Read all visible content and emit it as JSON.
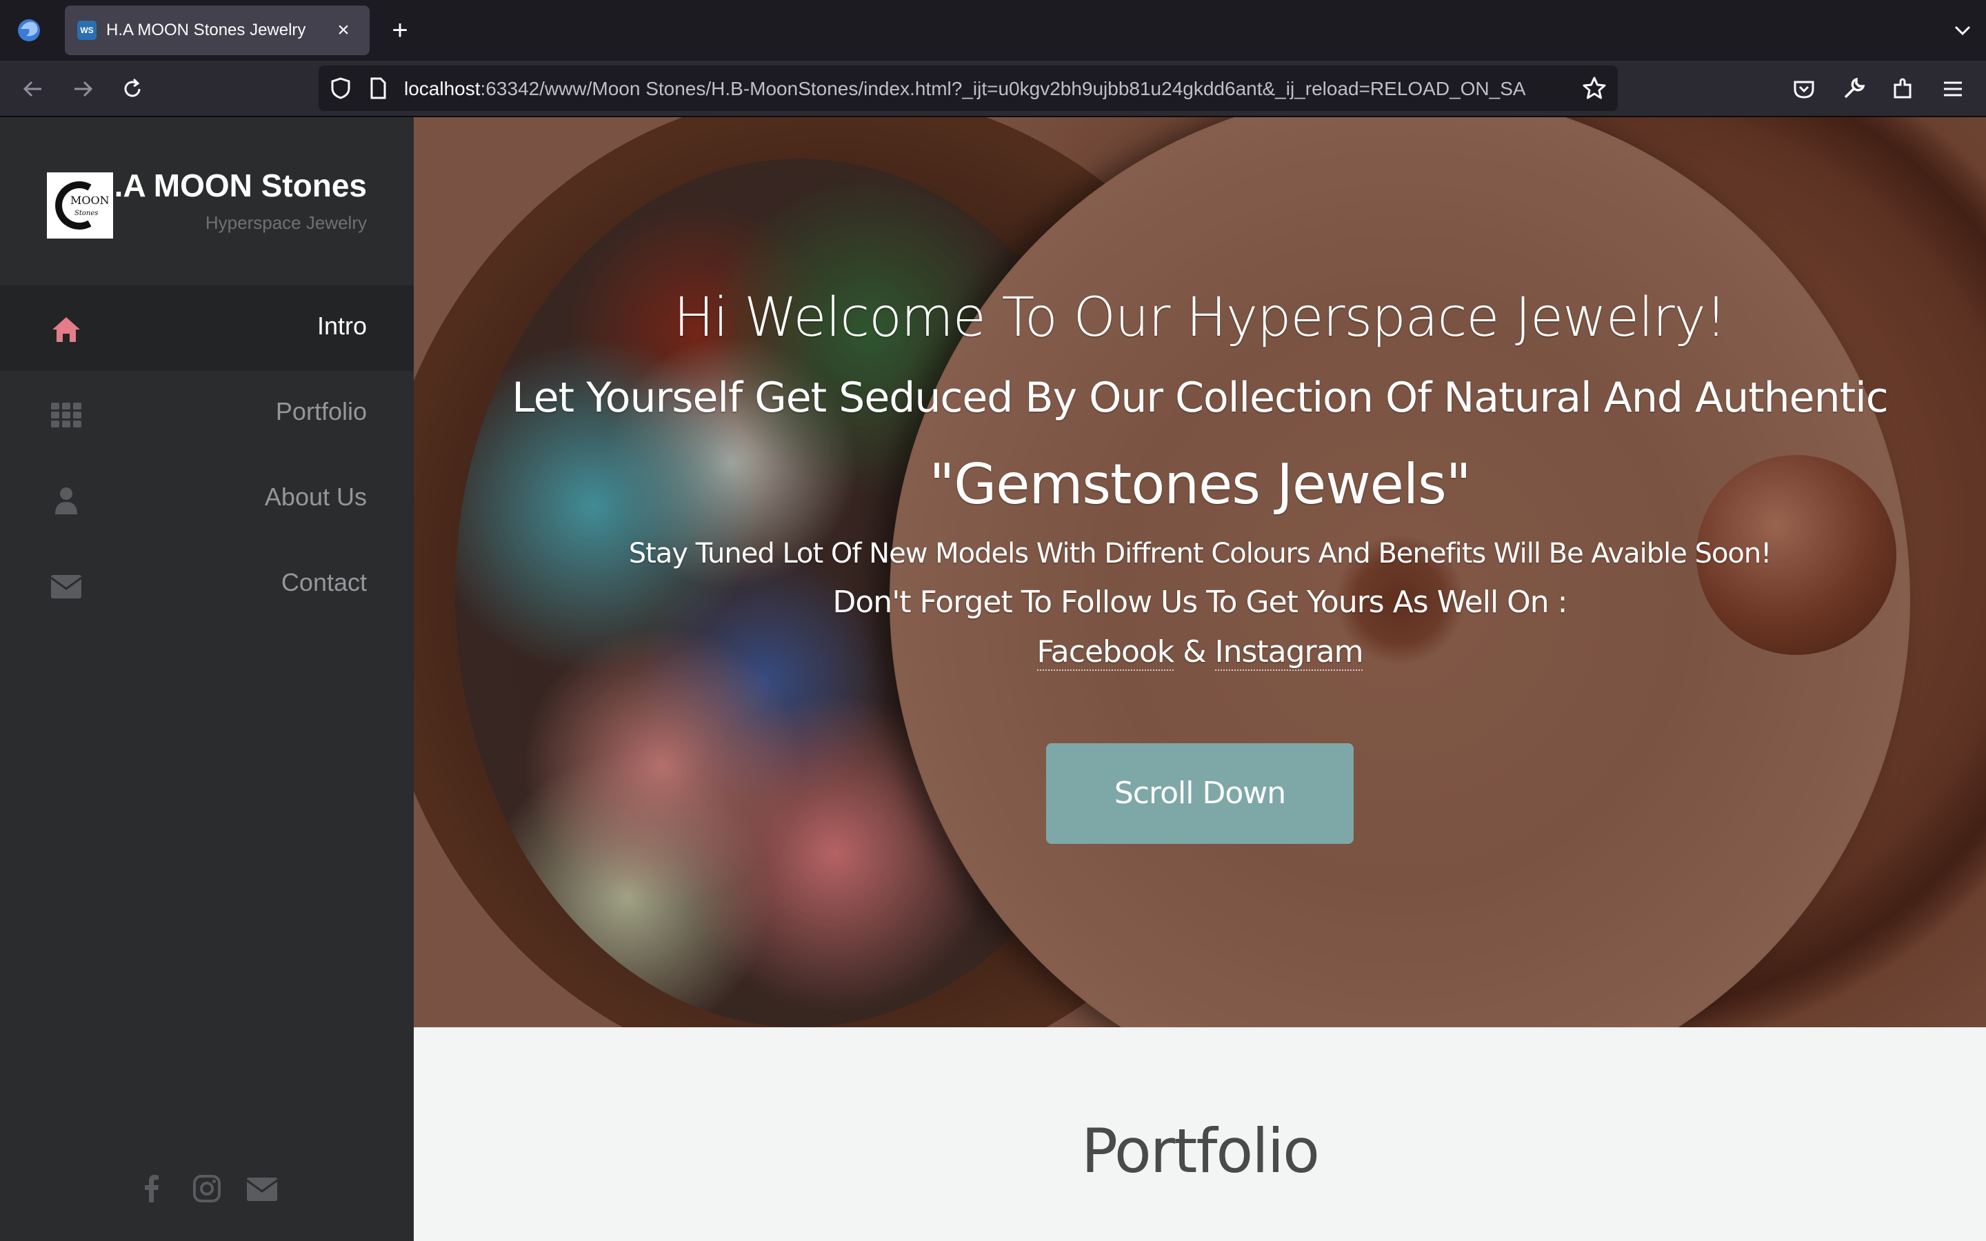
{
  "browser": {
    "tab_title": "H.A MOON Stones Jewelry",
    "tab_favicon_text": "WS",
    "url_host": "localhost",
    "url_rest": ":63342/www/Moon Stones/H.B-MoonStones/index.html?_ijt=u0kgv2bh9ujbb81u24gkdd6ant&_ij_reload=RELOAD_ON_SA"
  },
  "sidebar": {
    "brand_title": "H.A MOON Stones",
    "brand_subtitle": "Hyperspace Jewelry",
    "logo_text": "MOON",
    "items": [
      {
        "label": "Intro",
        "icon": "home-icon",
        "active": true
      },
      {
        "label": "Portfolio",
        "icon": "grid-icon",
        "active": false
      },
      {
        "label": "About Us",
        "icon": "user-icon",
        "active": false
      },
      {
        "label": "Contact",
        "icon": "envelope-icon",
        "active": false
      }
    ],
    "social": [
      "facebook-icon",
      "instagram-icon",
      "envelope-icon"
    ],
    "active_icon_color": "#e47c8a"
  },
  "hero": {
    "welcome": "Hi Welcome To Our Hyperspace Jewelry!",
    "line2": "Let Yourself Get Seduced By Our Collection Of Natural And Authentic",
    "line3": "\"Gemstones Jewels\"",
    "line4": "Stay Tuned Lot Of New Models With Diffrent Colours And Benefits Will Be Avaible Soon!",
    "line5": "Don't Forget To Follow Us To Get Yours As Well On :",
    "link_facebook": "Facebook",
    "link_amp": "&",
    "link_instagram": "Instagram",
    "button": "Scroll Down",
    "button_color": "#7ea8a7"
  },
  "portfolio": {
    "title": "Portfolio"
  }
}
